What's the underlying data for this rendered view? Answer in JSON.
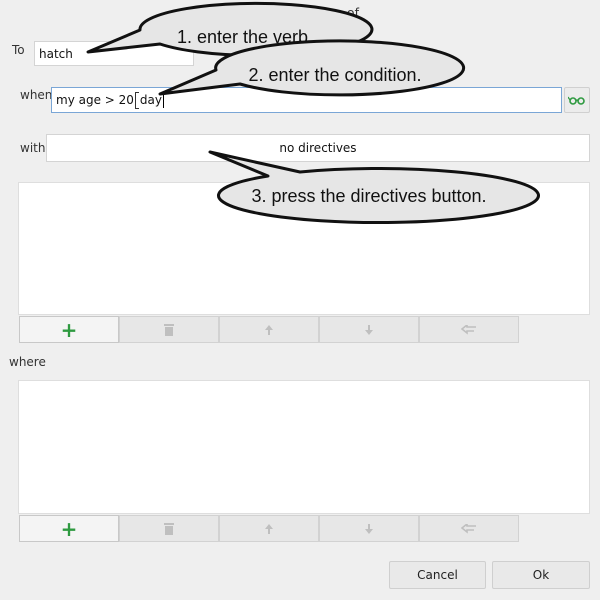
{
  "dialog": {
    "title": "Action definition of",
    "to_label": "To",
    "verb_value": "hatch",
    "when_label": "when",
    "condition_prefix": "my age > 20",
    "condition_unit": "day",
    "with_label": "with",
    "directives_label": "no directives",
    "where_label": "where"
  },
  "toolbar_icons": [
    "plus-icon",
    "trash-icon",
    "arrow-up-icon",
    "arrow-down-icon",
    "return-icon"
  ],
  "footer": {
    "cancel_label": "Cancel",
    "ok_label": "Ok"
  },
  "callouts": {
    "step1": "1. enter the verb.",
    "step2": "2. enter the condition.",
    "step3": "3. press the directives button."
  },
  "colors": {
    "plus": "#2e9a40",
    "focus_border": "#7aa6d6",
    "bubble_fill": "#e6e6e6"
  }
}
